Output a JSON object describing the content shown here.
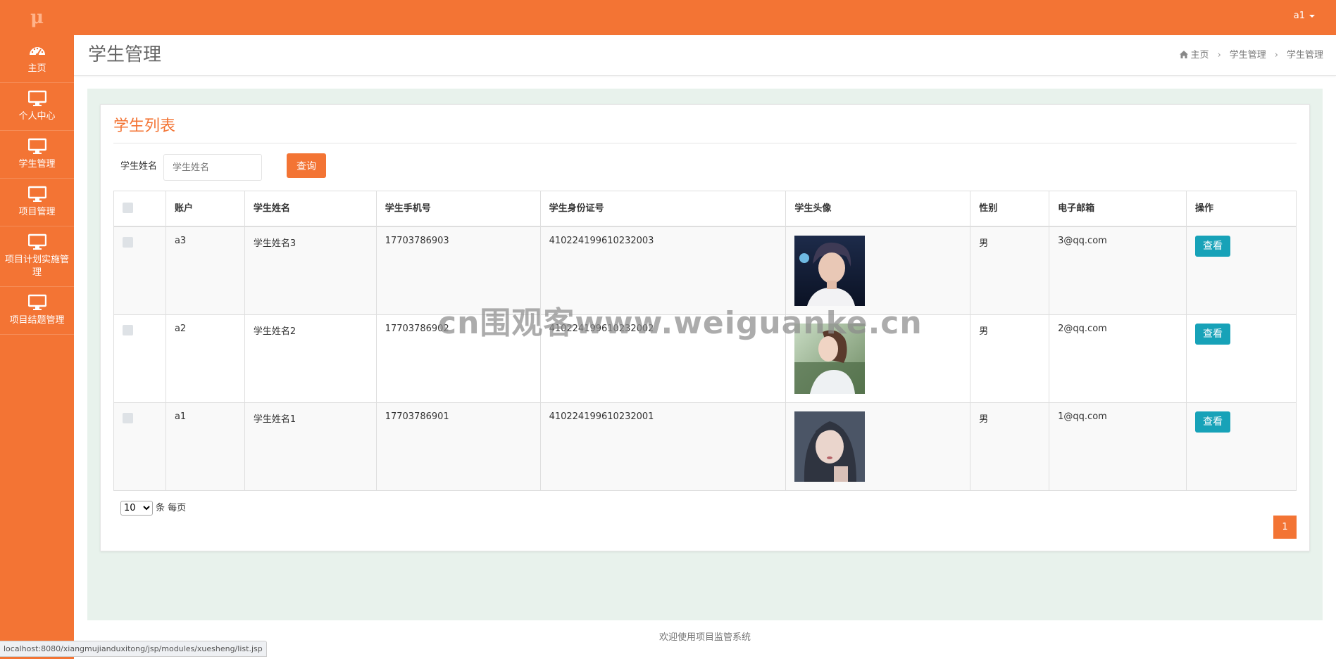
{
  "app": {
    "logo": "μ",
    "user": "a1"
  },
  "sidebar": {
    "items": [
      {
        "label": "主页",
        "icon": "dashboard-icon"
      },
      {
        "label": "个人中心",
        "icon": "monitor-icon"
      },
      {
        "label": "学生管理",
        "icon": "monitor-icon"
      },
      {
        "label": "项目管理",
        "icon": "monitor-icon"
      },
      {
        "label": "项目计划实施管理",
        "icon": "monitor-icon"
      },
      {
        "label": "项目结题管理",
        "icon": "monitor-icon"
      }
    ]
  },
  "header": {
    "title": "学生管理",
    "breadcrumb": [
      "主页",
      "学生管理",
      "学生管理"
    ]
  },
  "panel": {
    "title": "学生列表",
    "search_label": "学生姓名",
    "search_placeholder": "学生姓名",
    "search_button": "查询"
  },
  "table": {
    "headers": [
      "账户",
      "学生姓名",
      "学生手机号",
      "学生身份证号",
      "学生头像",
      "性别",
      "电子邮箱",
      "操作"
    ],
    "rows": [
      {
        "account": "a3",
        "name": "学生姓名3",
        "phone": "17703786903",
        "idcard": "410224199610232003",
        "gender": "男",
        "email": "3@qq.com",
        "action": "查看"
      },
      {
        "account": "a2",
        "name": "学生姓名2",
        "phone": "17703786902",
        "idcard": "410224199610232002",
        "gender": "男",
        "email": "2@qq.com",
        "action": "查看"
      },
      {
        "account": "a1",
        "name": "学生姓名1",
        "phone": "17703786901",
        "idcard": "410224199610232001",
        "gender": "男",
        "email": "1@qq.com",
        "action": "查看"
      }
    ]
  },
  "pagination": {
    "page_size": "10",
    "page_size_suffix": "条 每页",
    "current_page": "1"
  },
  "footer": {
    "text": "欢迎使用项目监管系统"
  },
  "status_url": "localhost:8080/xiangmujianduxitong/jsp/modules/xuesheng/list.jsp",
  "watermark": "cn围观客www.weiguanke.cn",
  "colors": {
    "brand": "#f37434",
    "view_button": "#17a2b8",
    "content_bg": "#e8f2ec"
  }
}
